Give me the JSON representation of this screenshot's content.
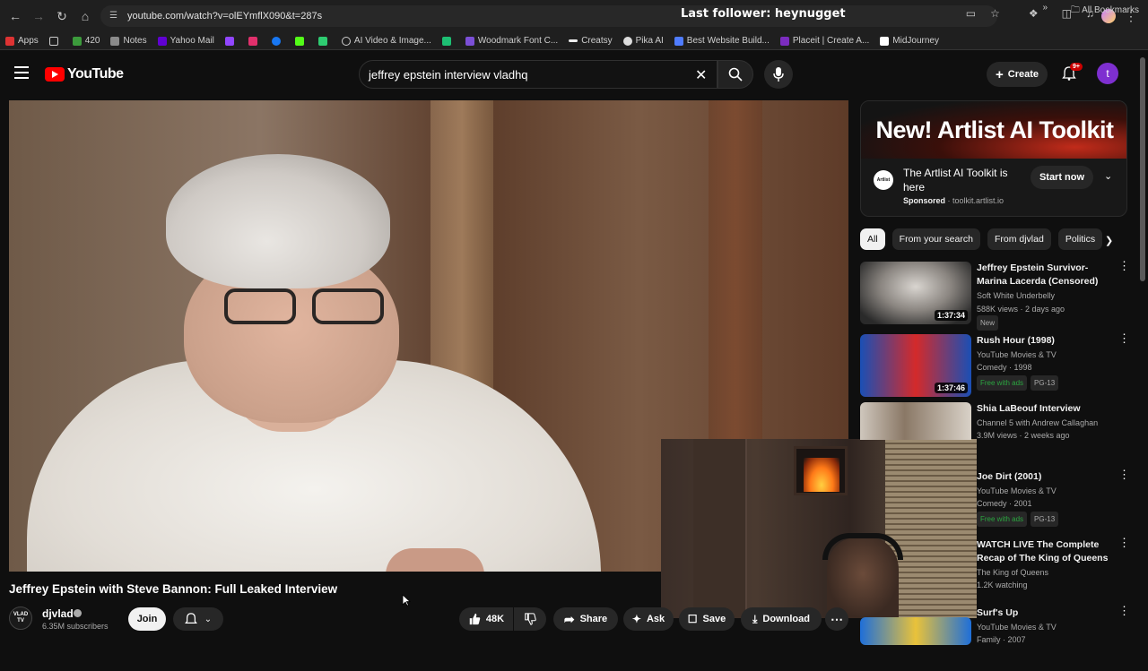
{
  "browser": {
    "url": "youtube.com/watch?v=olEYmflX090&t=287s",
    "overlay_text": "Last follower: heynugget",
    "bookmarks": [
      "Apps",
      "420",
      "Notes",
      "Yahoo Mail",
      "AI Video & Image...",
      "Woodmark Font C...",
      "Creatsy",
      "Pika AI",
      "Best Website Build...",
      "Placeit | Create A...",
      "MidJourney"
    ],
    "all_bookmarks": "All Bookmarks"
  },
  "header": {
    "logo_text": "YouTube",
    "search_query": "jeffrey epstein interview vladhq",
    "create_label": "Create",
    "notification_count": "9+",
    "avatar_initial": "t"
  },
  "video": {
    "title": "Jeffrey Epstein with Steve Bannon: Full Leaked Interview",
    "channel": "djvlad",
    "channel_avatar_text": "VLAD TV",
    "subscribers": "6.35M subscribers",
    "join_label": "Join",
    "likes": "48K",
    "share_label": "Share",
    "ask_label": "Ask",
    "save_label": "Save",
    "download_label": "Download"
  },
  "ad": {
    "banner_text": "New! Artlist AI Toolkit",
    "logo_text": "Artlist",
    "title": "The Artlist AI Toolkit is here",
    "sponsored": "Sponsored",
    "domain": "toolkit.artlist.io",
    "cta": "Start now"
  },
  "chips": [
    "All",
    "From your search",
    "From djvlad",
    "Politics"
  ],
  "recommendations": [
    {
      "title": "Jeffrey Epstein Survivor-Marina Lacerda (Censored)",
      "channel": "Soft White Underbelly",
      "meta": "588K views · 2 days ago",
      "badge": "New",
      "duration": "1:37:34"
    },
    {
      "title": "Rush Hour (1998)",
      "channel": "YouTube Movies & TV",
      "meta": "Comedy · 1998",
      "badge": "Free with ads",
      "rating": "PG-13",
      "duration": "1:37:46"
    },
    {
      "title": "Shia LaBeouf Interview",
      "channel": "Channel 5 with Andrew Callaghan",
      "meta": "3.9M views · 2 weeks ago"
    },
    {
      "title": "Joe Dirt (2001)",
      "channel": "YouTube Movies & TV",
      "meta": "Comedy · 2001",
      "badge": "Free with ads",
      "rating": "PG-13"
    },
    {
      "title": "WATCH LIVE The Complete Recap of The King of Queens",
      "channel": "The King of Queens",
      "meta": "1.2K watching"
    },
    {
      "title": "Surf's Up",
      "channel": "YouTube Movies & TV",
      "meta": "Family · 2007"
    }
  ]
}
